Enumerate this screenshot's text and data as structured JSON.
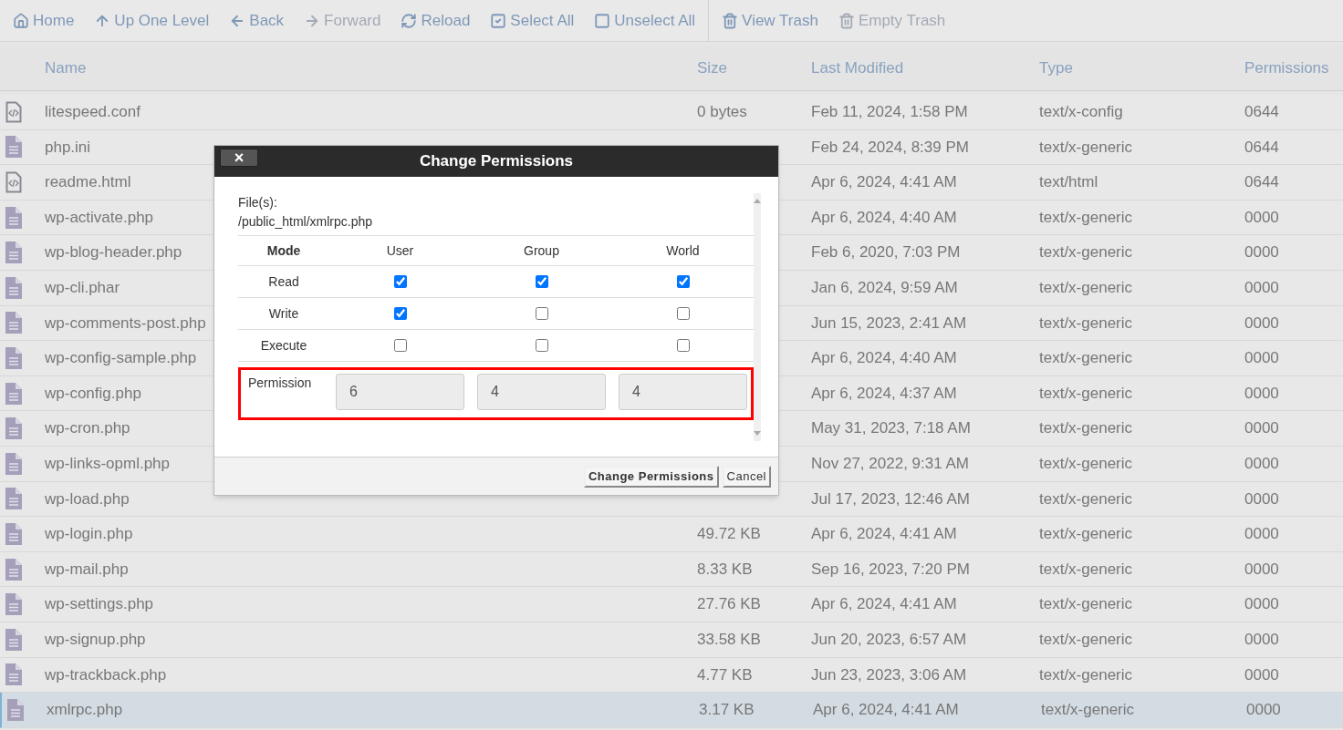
{
  "toolbar": {
    "groups": [
      [
        {
          "label": "Home",
          "disabled": false
        },
        {
          "label": "Up One Level",
          "disabled": false
        },
        {
          "label": "Back",
          "disabled": false
        },
        {
          "label": "Forward",
          "disabled": true
        },
        {
          "label": "Reload",
          "disabled": false
        },
        {
          "label": "Select All",
          "disabled": false
        },
        {
          "label": "Unselect All",
          "disabled": false
        }
      ],
      [
        {
          "label": "View Trash",
          "disabled": false
        },
        {
          "label": "Empty Trash",
          "disabled": true
        }
      ]
    ]
  },
  "table": {
    "columns": [
      "Name",
      "Size",
      "Last Modified",
      "Type",
      "Permissions"
    ],
    "rows": [
      {
        "kind": "code",
        "name": "litespeed.conf",
        "size": "0 bytes",
        "modified": "Feb 11, 2024, 1:58 PM",
        "type": "text/x-config",
        "permissions": "0644",
        "selected": false
      },
      {
        "kind": "text",
        "name": "php.ini",
        "modified": "Feb 24, 2024, 8:39 PM",
        "type": "text/x-generic",
        "permissions": "0644",
        "selected": false
      },
      {
        "kind": "code",
        "name": "readme.html",
        "modified": "Apr 6, 2024, 4:41 AM",
        "type": "text/html",
        "permissions": "0644",
        "selected": false
      },
      {
        "kind": "text",
        "name": "wp-activate.php",
        "modified": "Apr 6, 2024, 4:40 AM",
        "type": "text/x-generic",
        "permissions": "0000",
        "selected": false
      },
      {
        "kind": "text",
        "name": "wp-blog-header.php",
        "modified": "Feb 6, 2020, 7:03 PM",
        "type": "text/x-generic",
        "permissions": "0000",
        "selected": false
      },
      {
        "kind": "text",
        "name": "wp-cli.phar",
        "modified": "Jan 6, 2024, 9:59 AM",
        "type": "text/x-generic",
        "permissions": "0000",
        "selected": false
      },
      {
        "kind": "text",
        "name": "wp-comments-post.php",
        "modified": "Jun 15, 2023, 2:41 AM",
        "type": "text/x-generic",
        "permissions": "0000",
        "selected": false
      },
      {
        "kind": "text",
        "name": "wp-config-sample.php",
        "modified": "Apr 6, 2024, 4:40 AM",
        "type": "text/x-generic",
        "permissions": "0000",
        "selected": false
      },
      {
        "kind": "text",
        "name": "wp-config.php",
        "modified": "Apr 6, 2024, 4:37 AM",
        "type": "text/x-generic",
        "permissions": "0000",
        "selected": false
      },
      {
        "kind": "text",
        "name": "wp-cron.php",
        "modified": "May 31, 2023, 7:18 AM",
        "type": "text/x-generic",
        "permissions": "0000",
        "selected": false
      },
      {
        "kind": "text",
        "name": "wp-links-opml.php",
        "modified": "Nov 27, 2022, 9:31 AM",
        "type": "text/x-generic",
        "permissions": "0000",
        "selected": false
      },
      {
        "kind": "text",
        "name": "wp-load.php",
        "modified": "Jul 17, 2023, 12:46 AM",
        "type": "text/x-generic",
        "permissions": "0000",
        "selected": false
      },
      {
        "kind": "text",
        "name": "wp-login.php",
        "size": "49.72 KB",
        "modified": "Apr 6, 2024, 4:41 AM",
        "type": "text/x-generic",
        "permissions": "0000",
        "selected": false
      },
      {
        "kind": "text",
        "name": "wp-mail.php",
        "size": "8.33 KB",
        "modified": "Sep 16, 2023, 7:20 PM",
        "type": "text/x-generic",
        "permissions": "0000",
        "selected": false
      },
      {
        "kind": "text",
        "name": "wp-settings.php",
        "size": "27.76 KB",
        "modified": "Apr 6, 2024, 4:41 AM",
        "type": "text/x-generic",
        "permissions": "0000",
        "selected": false
      },
      {
        "kind": "text",
        "name": "wp-signup.php",
        "size": "33.58 KB",
        "modified": "Jun 20, 2023, 6:57 AM",
        "type": "text/x-generic",
        "permissions": "0000",
        "selected": false
      },
      {
        "kind": "text",
        "name": "wp-trackback.php",
        "size": "4.77 KB",
        "modified": "Jun 23, 2023, 3:06 AM",
        "type": "text/x-generic",
        "permissions": "0000",
        "selected": false
      },
      {
        "kind": "text",
        "name": "xmlrpc.php",
        "size": "3.17 KB",
        "modified": "Apr 6, 2024, 4:41 AM",
        "type": "text/x-generic",
        "permissions": "0000",
        "selected": true
      }
    ]
  },
  "dialog": {
    "title": "Change Permissions",
    "close": "×",
    "files_label": "File(s):",
    "path": "/public_html/xmlrpc.php",
    "mode_header": "Mode",
    "classes": [
      "User",
      "Group",
      "World"
    ],
    "modes": [
      {
        "label": "Read",
        "checks": [
          true,
          true,
          true
        ]
      },
      {
        "label": "Write",
        "checks": [
          true,
          false,
          false
        ]
      },
      {
        "label": "Execute",
        "checks": [
          false,
          false,
          false
        ]
      }
    ],
    "permission": {
      "label": "Permission",
      "values": [
        "6",
        "4",
        "4"
      ],
      "highlighted": true
    },
    "buttons": [
      {
        "label": "Change Permissions",
        "kind": "primary"
      },
      {
        "label": "Cancel",
        "kind": "secondary"
      }
    ]
  }
}
